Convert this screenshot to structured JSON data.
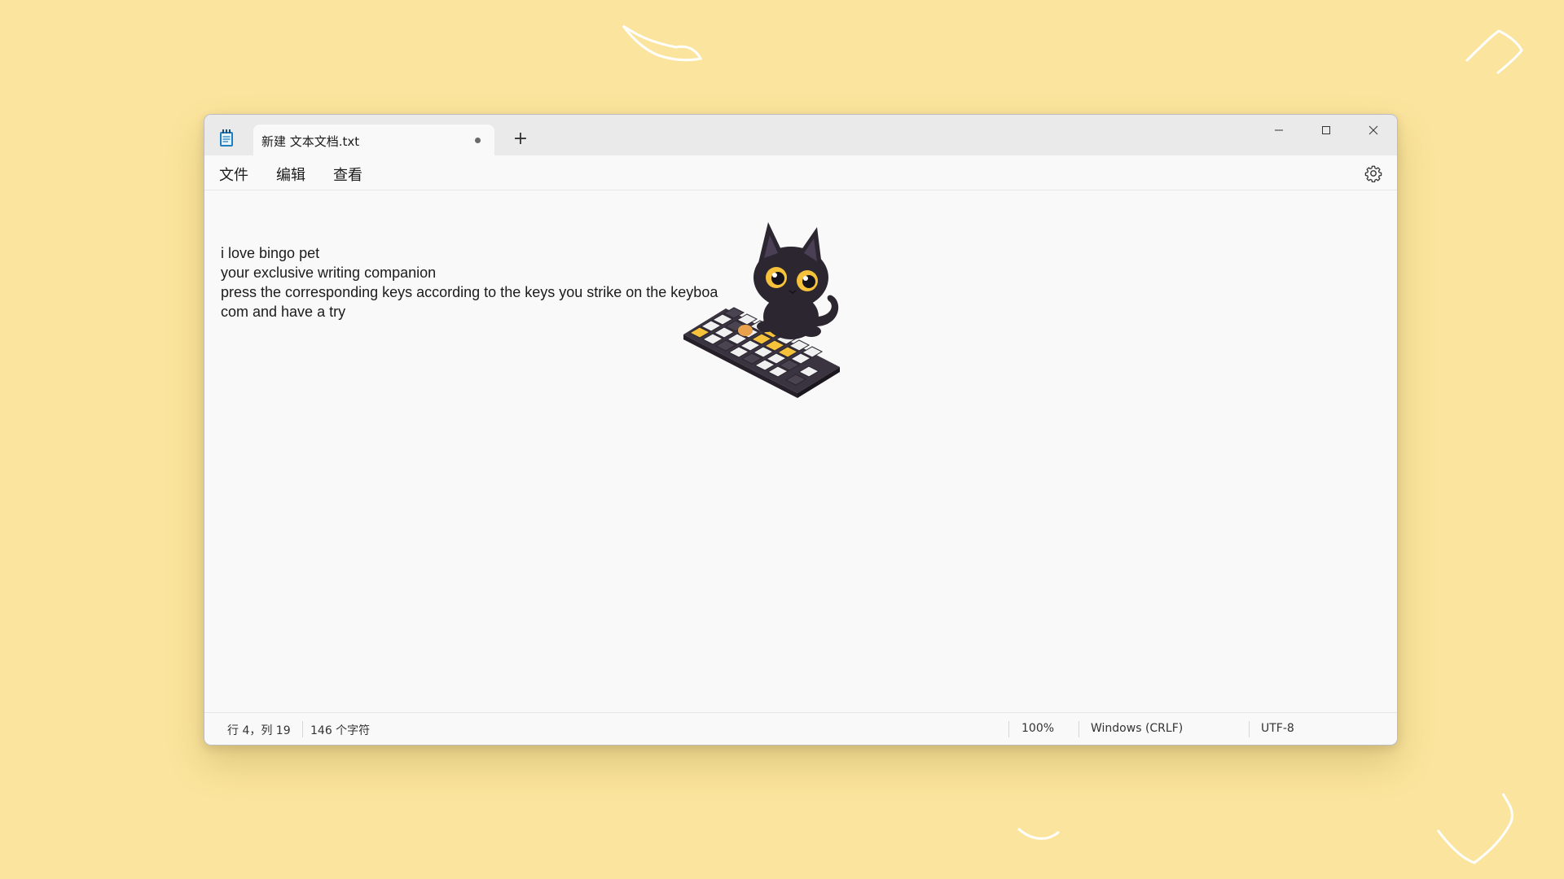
{
  "window": {
    "tab_title": "新建 文本文档.txt",
    "new_tab_label": "+",
    "menu": [
      "文件",
      "编辑",
      "查看"
    ]
  },
  "editor": {
    "lines": [
      "i love bingo pet",
      "your exclusive writing companion",
      "press the corresponding keys according to the keys you strike on the keyboa",
      "com and have a try"
    ]
  },
  "status": {
    "position": "行 4，列 19",
    "char_count": "146 个字符",
    "zoom": "100%",
    "line_ending": "Windows (CRLF)",
    "encoding": "UTF-8"
  },
  "icons": {
    "app": "notepad-icon",
    "minimize": "minimize-icon",
    "maximize": "maximize-icon",
    "close": "close-icon",
    "settings": "gear-icon",
    "pet": "cat-pet-icon"
  },
  "colors": {
    "background": "#fbe49d",
    "window": "#f9f9f9",
    "titlebar": "#eaeaea",
    "accent": "#f6c23b"
  }
}
